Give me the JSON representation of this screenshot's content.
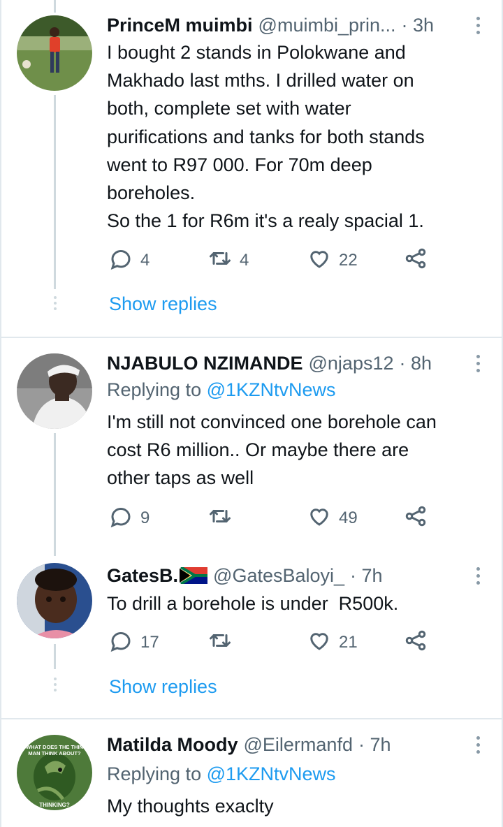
{
  "tweets": [
    {
      "name": "PrinceM muimbi",
      "handle": "@muimbi_prin...",
      "time": "· 3h",
      "body": [
        "I bought 2 stands in Polokwane and",
        "Makhado last mths. I drilled water on",
        "both, complete set with water",
        "purifications and tanks for both stands",
        "went to R97 000. For 70m deep",
        "boreholes.",
        "So the 1 for R6m it's a realy spacial 1."
      ],
      "replies": "4",
      "retweets": "4",
      "likes": "22",
      "show_replies": "Show replies"
    },
    {
      "name": "NJABULO NZIMANDE",
      "handle": "@njaps12",
      "time": "· 8h",
      "replying_label": "Replying to",
      "replying_to": "@1KZNtvNews",
      "body": [
        "I'm still not convinced one borehole can",
        "cost R6 million.. Or maybe there are",
        "other taps as well"
      ],
      "replies": "9",
      "retweets": "",
      "likes": "49"
    },
    {
      "name": "GatesB.",
      "name_flag": "south-africa-flag",
      "handle": "@GatesBaloyi_",
      "time": "· 7h",
      "body": [
        "To drill a borehole is under  R500k."
      ],
      "replies": "17",
      "retweets": "",
      "likes": "21",
      "show_replies": "Show replies"
    },
    {
      "name": "Matilda Moody",
      "handle": "@Eilermanfd",
      "time": "· 7h",
      "replying_label": "Replying to",
      "replying_to": "@1KZNtvNews",
      "body": [
        "My thoughts exaclty"
      ],
      "avatar_text_top": "WHAT DOES THE THIN MAN THINK ABOUT?",
      "avatar_text_bottom": "THINKING?"
    }
  ],
  "icons": {
    "reply": "reply-icon",
    "retweet": "retweet-icon",
    "like": "heart-icon",
    "share": "share-icon",
    "more": "more-vertical-icon"
  },
  "colors": {
    "link": "#1d9bf0",
    "secondary_text": "#536471",
    "primary_text": "#0f1419",
    "thread_line": "#cfd9de"
  }
}
